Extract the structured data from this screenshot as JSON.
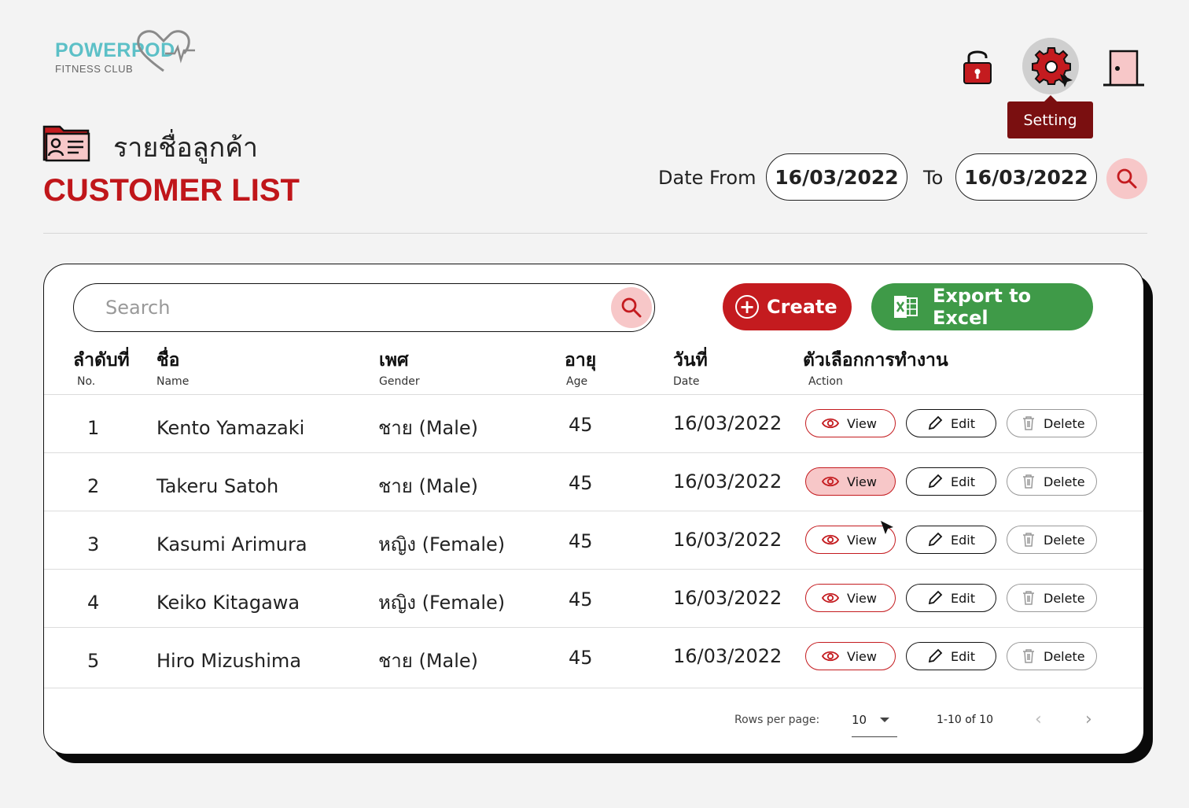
{
  "logo": {
    "name": "POWERPOD",
    "subtitle": "FITNESS CLUB"
  },
  "header": {
    "tooltip": "Setting",
    "title_th": "รายชื่อลูกค้า",
    "title_en": "CUSTOMER LIST"
  },
  "filter": {
    "date_from_label": "Date From",
    "date_from": "16/03/2022",
    "to_label": "To",
    "date_to": "16/03/2022"
  },
  "toolbar": {
    "search_placeholder": "Search",
    "create_label": "Create",
    "export_label": "Export to Excel"
  },
  "columns": [
    {
      "th": "ลำดับที่",
      "en": "No."
    },
    {
      "th": "ชื่อ",
      "en": "Name"
    },
    {
      "th": "เพศ",
      "en": "Gender"
    },
    {
      "th": "อายุ",
      "en": "Age"
    },
    {
      "th": "วันที่",
      "en": "Date"
    },
    {
      "th": "ตัวเลือกการทำงาน",
      "en": "Action"
    }
  ],
  "actions": {
    "view": "View",
    "edit": "Edit",
    "delete": "Delete"
  },
  "rows": [
    {
      "no": "1",
      "name": "Kento Yamazaki",
      "gender": "ชาย (Male)",
      "age": "45",
      "date": "16/03/2022"
    },
    {
      "no": "2",
      "name": "Takeru Satoh",
      "gender": "ชาย (Male)",
      "age": "45",
      "date": "16/03/2022"
    },
    {
      "no": "3",
      "name": "Kasumi Arimura",
      "gender": "หญิง (Female)",
      "age": "45",
      "date": "16/03/2022"
    },
    {
      "no": "4",
      "name": "Keiko Kitagawa",
      "gender": "หญิง (Female)",
      "age": "45",
      "date": "16/03/2022"
    },
    {
      "no": "5",
      "name": "Hiro Mizushima",
      "gender": "ชาย (Male)",
      "age": "45",
      "date": "16/03/2022"
    }
  ],
  "pagination": {
    "rows_per_page_label": "Rows per page:",
    "rows_per_page": "10",
    "range": "1-10 of 10",
    "prev_icon": "‹",
    "next_icon": "›"
  },
  "colors": {
    "brand_red": "#c41b1f",
    "dark_red": "#7a0f10",
    "pink": "#f7c7c8",
    "green": "#3f9a48",
    "teal": "#5cc0c7"
  }
}
